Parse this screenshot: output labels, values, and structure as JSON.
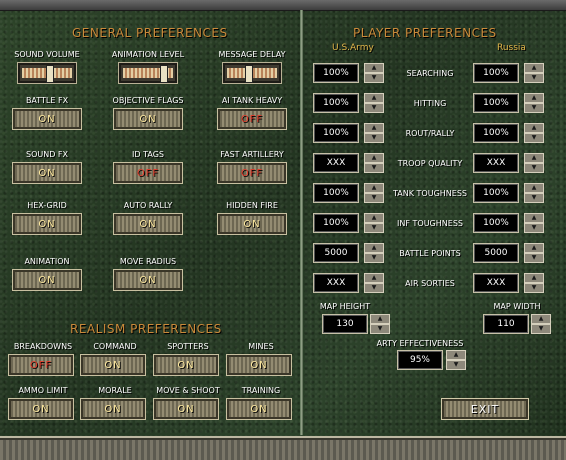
{
  "general": {
    "title": "GENERAL PREFERENCES",
    "sliders": [
      {
        "label": "SOUND VOLUME",
        "level": 0.55
      },
      {
        "label": "ANIMATION LEVEL",
        "level": 0.85
      },
      {
        "label": "MESSAGE DELAY",
        "level": 0.4
      }
    ],
    "toggles": [
      {
        "label": "BATTLE FX",
        "value": "ON"
      },
      {
        "label": "OBJECTIVE FLAGS",
        "value": "ON"
      },
      {
        "label": "AI TANK HEAVY",
        "value": "OFF"
      },
      {
        "label": "SOUND FX",
        "value": "ON"
      },
      {
        "label": "ID TAGS",
        "value": "OFF"
      },
      {
        "label": "FAST ARTILLERY",
        "value": "OFF"
      },
      {
        "label": "HEX-GRID",
        "value": "ON"
      },
      {
        "label": "AUTO RALLY",
        "value": "ON"
      },
      {
        "label": "HIDDEN FIRE",
        "value": "ON"
      },
      {
        "label": "ANIMATION",
        "value": "ON"
      },
      {
        "label": "MOVE RADIUS",
        "value": "ON"
      }
    ]
  },
  "realism": {
    "title": "REALISM PREFERENCES",
    "toggles": [
      {
        "label": "BREAKDOWNS",
        "value": "OFF"
      },
      {
        "label": "COMMAND",
        "value": "ON"
      },
      {
        "label": "SPOTTERS",
        "value": "ON"
      },
      {
        "label": "MINES",
        "value": "ON"
      },
      {
        "label": "AMMO LIMIT",
        "value": "ON"
      },
      {
        "label": "MORALE",
        "value": "ON"
      },
      {
        "label": "MOVE & SHOOT",
        "value": "ON"
      },
      {
        "label": "TRAINING",
        "value": "ON"
      }
    ]
  },
  "player": {
    "title": "PLAYER PREFERENCES",
    "side_a": "U.S.Army",
    "side_b": "Russia",
    "rows": [
      {
        "label": "SEARCHING",
        "a": "100%",
        "b": "100%"
      },
      {
        "label": "HITTING",
        "a": "100%",
        "b": "100%"
      },
      {
        "label": "ROUT/RALLY",
        "a": "100%",
        "b": "100%"
      },
      {
        "label": "TROOP QUALITY",
        "a": "XXX",
        "b": "XXX"
      },
      {
        "label": "TANK TOUGHNESS",
        "a": "100%",
        "b": "100%"
      },
      {
        "label": "INF TOUGHNESS",
        "a": "100%",
        "b": "100%"
      },
      {
        "label": "BATTLE POINTS",
        "a": "5000",
        "b": "5000"
      },
      {
        "label": "AIR SORTIES",
        "a": "XXX",
        "b": "XXX"
      }
    ],
    "map_height": {
      "label": "MAP HEIGHT",
      "value": "130"
    },
    "map_width": {
      "label": "MAP WIDTH",
      "value": "110"
    },
    "arty": {
      "label": "ARTY EFFECTIVENESS",
      "value": "95%"
    }
  },
  "exit_label": "EXIT",
  "spin_up_icon": "▲",
  "spin_down_icon": "▼"
}
